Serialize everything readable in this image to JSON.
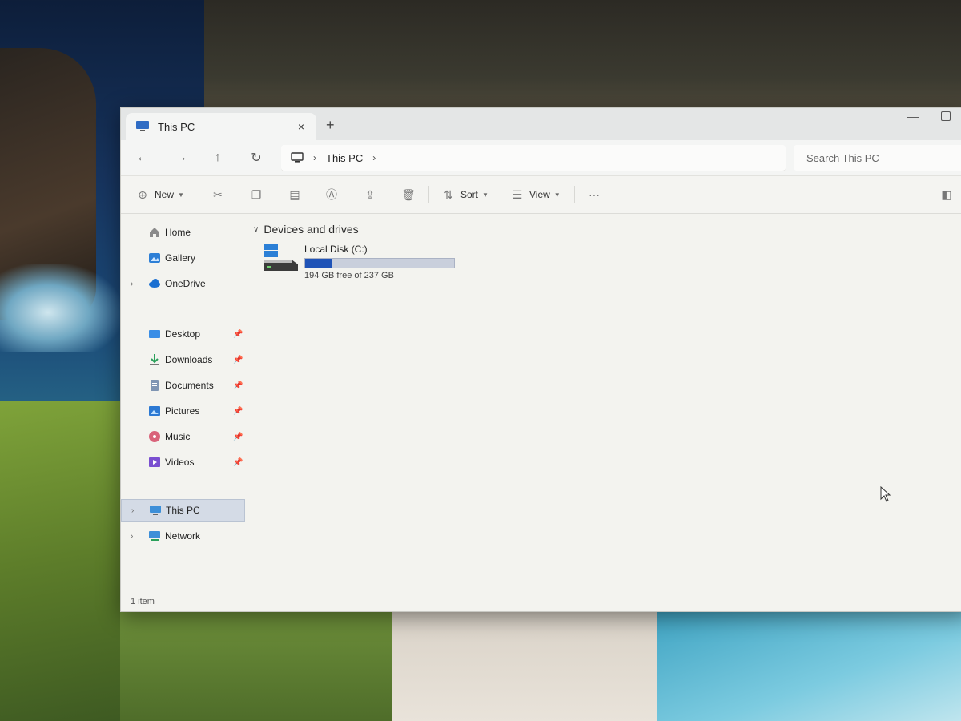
{
  "window": {
    "tab_title": "This PC",
    "tab_close": "×",
    "new_tab": "+"
  },
  "navigation": {
    "back": "←",
    "forward": "→",
    "up": "↑",
    "refresh": "↻",
    "breadcrumb": [
      "This PC"
    ],
    "crumb_separator": "›",
    "search_placeholder": "Search This PC"
  },
  "toolbar": {
    "new_label": "New",
    "sort_label": "Sort",
    "view_label": "View",
    "more_label": "···"
  },
  "sidebar": {
    "top_items": [
      {
        "label": "Home",
        "icon": "home-icon"
      },
      {
        "label": "Gallery",
        "icon": "gallery-icon"
      },
      {
        "label": "OneDrive",
        "icon": "cloud-icon"
      }
    ],
    "quick_access": [
      {
        "label": "Desktop",
        "icon": "desktop-folder-icon"
      },
      {
        "label": "Downloads",
        "icon": "downloads-icon"
      },
      {
        "label": "Documents",
        "icon": "documents-icon"
      },
      {
        "label": "Pictures",
        "icon": "pictures-icon"
      },
      {
        "label": "Music",
        "icon": "music-icon"
      },
      {
        "label": "Videos",
        "icon": "videos-icon"
      }
    ],
    "bottom_items": [
      {
        "label": "This PC",
        "icon": "pc-icon",
        "selected": true
      },
      {
        "label": "Network",
        "icon": "network-icon"
      }
    ]
  },
  "content": {
    "group_title": "Devices and drives",
    "drive": {
      "name": "Local Disk (C:)",
      "free_text": "194 GB free of 237 GB",
      "used_fraction": 0.18
    }
  },
  "status": {
    "item_count": "1 item"
  },
  "colors": {
    "accent": "#1f53b7",
    "selected_bg": "#d4dbe6"
  }
}
